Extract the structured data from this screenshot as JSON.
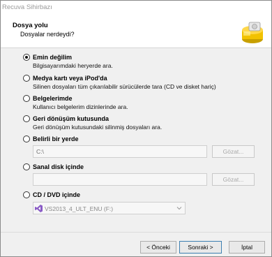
{
  "window": {
    "title": "Recuva Sihirbazı"
  },
  "header": {
    "title": "Dosya yolu",
    "subtitle": "Dosyalar nerdeydi?"
  },
  "options": [
    {
      "label": "Emin değilim",
      "description": "Bilgisayarımdaki heryerde ara.",
      "checked": true
    },
    {
      "label": "Medya kartı veya iPod'da",
      "description": "Silinen dosyaları tüm çıkarılabilir sürücülerde tara (CD ve disket hariç)",
      "checked": false
    },
    {
      "label": "Belgelerimde",
      "description": "Kullanıcı belgelerim dizinlerinde ara.",
      "checked": false
    },
    {
      "label": "Geri dönüşüm kutusunda",
      "description": "Geri dönüşüm kutusundaki silinmiş dosyaları ara.",
      "checked": false
    },
    {
      "label": "Belirli bir yerde",
      "checked": false,
      "field_value": "C:\\",
      "browse_label": "Gözat..."
    },
    {
      "label": "Sanal disk içinde",
      "checked": false,
      "field_value": "",
      "browse_label": "Gözat..."
    },
    {
      "label": "CD / DVD içinde",
      "checked": false,
      "combo_value": "VS2013_4_ULT_ENU (F:)"
    }
  ],
  "buttons": {
    "back": "< Önceki",
    "next": "Sonraki >",
    "cancel": "İptal"
  }
}
